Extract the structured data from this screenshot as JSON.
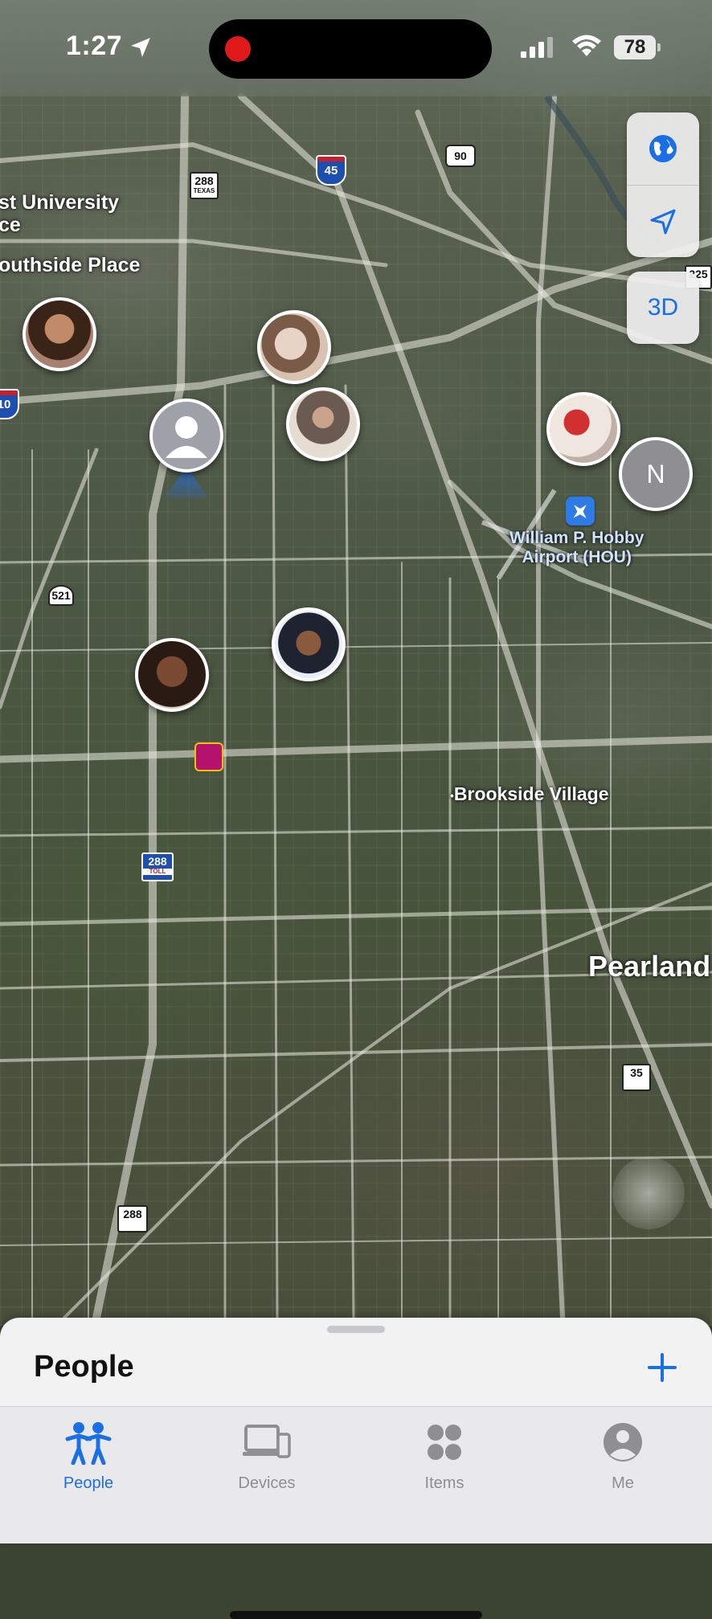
{
  "status_bar": {
    "time": "1:27",
    "battery": "78"
  },
  "map": {
    "labels": {
      "university": "st University\nce",
      "southside": "outhside Place",
      "airport": "William P. Hobby\nAirport (HOU)",
      "brookside": "Brookside Village",
      "pearland": "Pearland"
    },
    "shields": {
      "i45": "45",
      "us90": "90",
      "tx288_top": "288",
      "tx288_mid": "288",
      "tx288_bottom": "288",
      "tx35": "35",
      "i225": "225",
      "i610": "10",
      "fm521": "521",
      "texas_small": "TEXAS",
      "toll": "TOLL"
    },
    "people": [
      {
        "initial": ""
      },
      {
        "initial": ""
      },
      {
        "initial": ""
      },
      {
        "initial": ""
      },
      {
        "initial": ""
      },
      {
        "initial": ""
      },
      {
        "initial": "N"
      }
    ],
    "controls": {
      "view_3d": "3D"
    }
  },
  "sheet": {
    "title": "People"
  },
  "tabbar": {
    "tabs": [
      {
        "label": "People",
        "active": true
      },
      {
        "label": "Devices",
        "active": false
      },
      {
        "label": "Items",
        "active": false
      },
      {
        "label": "Me",
        "active": false
      }
    ]
  },
  "colors": {
    "accent": "#1a6ee6",
    "inactive": "#8e8e93"
  }
}
